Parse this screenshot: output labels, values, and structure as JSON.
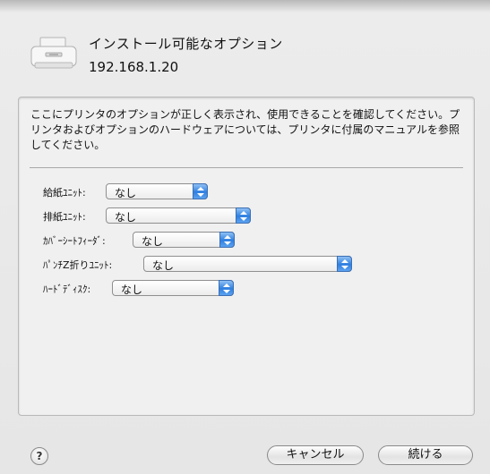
{
  "header": {
    "title": "インストール可能なオプション",
    "address": "192.168.1.20"
  },
  "description": "ここにプリンタのオプションが正しく表示され、使用できることを確認してください。プリンタおよびオプションのハードウェアについては、プリンタに付属のマニュアルを参照してください。",
  "options": [
    {
      "label": "給紙ﾕﾆｯﾄ:",
      "value": "なし"
    },
    {
      "label": "排紙ﾕﾆｯﾄ:",
      "value": "なし"
    },
    {
      "label": "ｶﾊﾞｰｼｰﾄﾌｨｰﾀﾞ:",
      "value": "なし"
    },
    {
      "label": "ﾊﾟﾝﾁZ折りﾕﾆｯﾄ:",
      "value": "なし"
    },
    {
      "label": "ﾊｰﾄﾞﾃﾞｨｽｸ:",
      "value": "なし"
    }
  ],
  "buttons": {
    "help": "?",
    "cancel": "キャンセル",
    "continue": "続ける"
  },
  "icons": {
    "printer": "printer-icon",
    "popup_arrow": "up-down-arrows-icon"
  },
  "colors": {
    "accent": "#2f7fe0"
  }
}
